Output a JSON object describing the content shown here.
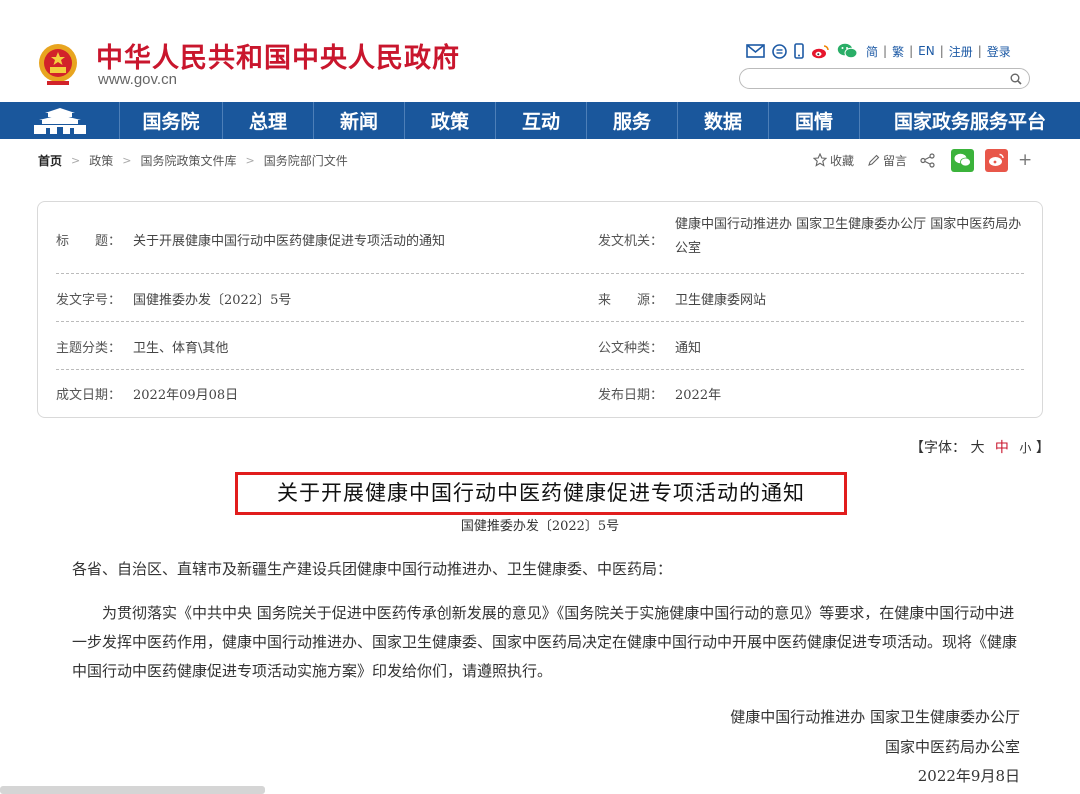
{
  "header": {
    "site_title": "中华人民共和国中央人民政府",
    "site_url": "www.gov.cn",
    "lang_links": [
      "简",
      "繁",
      "EN",
      "注册",
      "登录"
    ],
    "search_placeholder": ""
  },
  "nav": {
    "items": [
      "国务院",
      "总理",
      "新闻",
      "政策",
      "互动",
      "服务",
      "数据",
      "国情",
      "国家政务服务平台"
    ]
  },
  "breadcrumb": {
    "items": [
      "首页",
      "政策",
      "国务院政策文件库",
      "国务院部门文件"
    ]
  },
  "actions": {
    "favorite": "收藏",
    "comment": "留言"
  },
  "info": {
    "title_label": "标　　题：",
    "title_value": "关于开展健康中国行动中医药健康促进专项活动的通知",
    "issuer_label": "发文机关：",
    "issuer_value": "健康中国行动推进办 国家卫生健康委办公厅 国家中医药局办公室",
    "docno_label": "发文字号：",
    "docno_value": "国健推委办发〔2022〕5号",
    "source_label": "来　　源：",
    "source_value": "卫生健康委网站",
    "topic_label": "主题分类：",
    "topic_value": "卫生、体育\\其他",
    "doctype_label": "公文种类：",
    "doctype_value": "通知",
    "written_label": "成文日期：",
    "written_value": "2022年09月08日",
    "published_label": "发布日期：",
    "published_value": "2022年"
  },
  "font_size": {
    "prefix": "【字体：",
    "large": "大",
    "medium": "中",
    "small": "小",
    "suffix": "】"
  },
  "article": {
    "title": "关于开展健康中国行动中医药健康促进专项活动的通知",
    "doc_number": "国健推委办发〔2022〕5号",
    "addressee": "各省、自治区、直辖市及新疆生产建设兵团健康中国行动推进办、卫生健康委、中医药局：",
    "body": "为贯彻落实《中共中央 国务院关于促进中医药传承创新发展的意见》《国务院关于实施健康中国行动的意见》等要求，在健康中国行动中进一步发挥中医药作用，健康中国行动推进办、国家卫生健康委、国家中医药局决定在健康中国行动中开展中医药健康促进专项活动。现将《健康中国行动中医药健康促进专项活动实施方案》印发给你们，请遵照执行。",
    "sign_line1": "健康中国行动推进办 国家卫生健康委办公厅",
    "sign_line2": "国家中医药局办公室",
    "sign_date": "2022年9月8日"
  },
  "colors": {
    "brand_red": "#c9162d",
    "nav_blue": "#1a579c",
    "highlight_red": "#e11d1d"
  }
}
